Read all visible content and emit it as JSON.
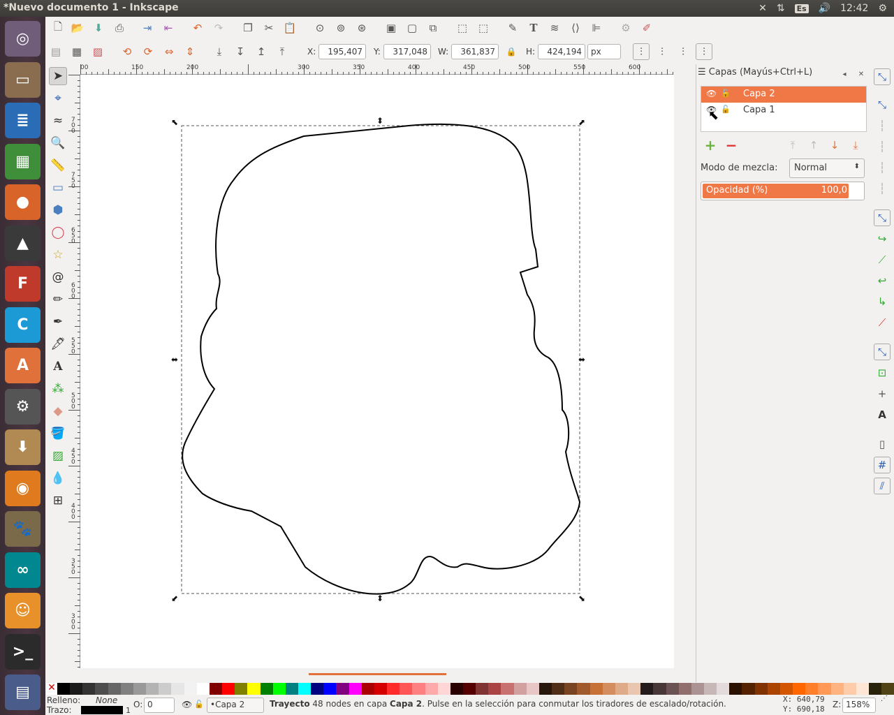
{
  "window": {
    "title": "*Nuevo documento 1 - Inkscape"
  },
  "tray": {
    "lang": "Es",
    "time": "12:42"
  },
  "launcher": [
    {
      "name": "ubuntu-dash-icon",
      "glyph": "◎",
      "bg": "#6f5d7a"
    },
    {
      "name": "files-icon",
      "glyph": "▭",
      "bg": "#8a6c4f"
    },
    {
      "name": "writer-icon",
      "glyph": "≣",
      "bg": "#2a6db6"
    },
    {
      "name": "calc-icon",
      "glyph": "▦",
      "bg": "#3f8f3a"
    },
    {
      "name": "firefox-icon",
      "glyph": "●",
      "bg": "#d9642a"
    },
    {
      "name": "inkscape-icon",
      "glyph": "▲",
      "bg": "#3a3a3a"
    },
    {
      "name": "fritzing-icon",
      "glyph": "F",
      "bg": "#c03a2b"
    },
    {
      "name": "cmaptools-icon",
      "glyph": "C",
      "bg": "#1b9ad6"
    },
    {
      "name": "software-center-icon",
      "glyph": "A",
      "bg": "#e1713a"
    },
    {
      "name": "settings-icon",
      "glyph": "⚙",
      "bg": "#555"
    },
    {
      "name": "archive-icon",
      "glyph": "⬇",
      "bg": "#b08a52"
    },
    {
      "name": "blender-icon",
      "glyph": "◉",
      "bg": "#e07a1f"
    },
    {
      "name": "gimp-icon",
      "glyph": "🐾",
      "bg": "#7a6a4a"
    },
    {
      "name": "arduino-icon",
      "glyph": "∞",
      "bg": "#00878f"
    },
    {
      "name": "scratch-icon",
      "glyph": "☺",
      "bg": "#e8902a"
    },
    {
      "name": "terminal-icon",
      "glyph": ">_",
      "bg": "#2b2b2b"
    },
    {
      "name": "workspace-icon",
      "glyph": "▤",
      "bg": "#4a5c8a"
    }
  ],
  "toolbar": {
    "x_label": "X:",
    "x_value": "195,407",
    "y_label": "Y:",
    "y_value": "317,048",
    "w_label": "W:",
    "w_value": "361,837",
    "h_label": "H:",
    "h_value": "424,194",
    "unit": "px"
  },
  "ruler": {
    "h_ticks": [
      "00",
      "150",
      "200",
      "300",
      "350",
      "400",
      "450",
      "500",
      "550",
      "600"
    ],
    "v_ticks": [
      "7",
      "0",
      "0",
      "7",
      "5",
      "0",
      "6",
      "5",
      "0",
      "6",
      "0",
      "0",
      "5",
      "5",
      "0",
      "5",
      "0",
      "0",
      "4",
      "5",
      "0",
      "4",
      "0",
      "0",
      "3",
      "5",
      "0",
      "3",
      "0",
      "0"
    ]
  },
  "layers": {
    "title": "Capas (Mayús+Ctrl+L)",
    "items": [
      {
        "name": "Capa 2",
        "selected": true
      },
      {
        "name": "Capa 1",
        "selected": false
      }
    ],
    "blend_label": "Modo de mezcla:",
    "blend_value": "Normal",
    "opacity_label": "Opacidad (%)",
    "opacity_value": "100,0",
    "opacity_fraction": 1.0
  },
  "status": {
    "fill_label": "Relleno:",
    "fill_value": "None",
    "stroke_label": "Trazo:",
    "stroke_width": "1",
    "o_label": "O:",
    "o_value": "0",
    "layer": "•Capa 2",
    "msg_bold1": "Trayecto",
    "msg1": " 48 nodes en capa ",
    "msg_bold2": "Capa 2",
    "msg2": ". Pulse en la selección para conmutar los tiradores de escalado/rotación.",
    "cx": "X:  640,79",
    "cy": "Y:  690,18",
    "zoom_label": "Z:",
    "zoom": "158%"
  },
  "palette": [
    "#000000",
    "#1a1a1a",
    "#333333",
    "#4d4d4d",
    "#666666",
    "#808080",
    "#999999",
    "#b3b3b3",
    "#cccccc",
    "#e6e6e6",
    "#f2f2f2",
    "#ffffff",
    "#800000",
    "#ff0000",
    "#808000",
    "#ffff00",
    "#008000",
    "#00ff00",
    "#008080",
    "#00ffff",
    "#000080",
    "#0000ff",
    "#800080",
    "#ff00ff",
    "#aa0000",
    "#d40000",
    "#ff2a2a",
    "#ff5555",
    "#ff8080",
    "#ffaaaa",
    "#ffd5d5",
    "#2b0000",
    "#550000",
    "#803333",
    "#aa4444",
    "#c87171",
    "#d3a0a0",
    "#e9c6c6",
    "#28170b",
    "#502d16",
    "#784421",
    "#a05a2c",
    "#c87137",
    "#d38d5f",
    "#deaa87",
    "#e9c6af",
    "#241c1c",
    "#483737",
    "#6c5353",
    "#916f6f",
    "#ac9393",
    "#c8b7b7",
    "#e3dbdb",
    "#2b1100",
    "#552200",
    "#803300",
    "#aa4400",
    "#d45500",
    "#ff6600",
    "#ff7f2a",
    "#ff9955",
    "#ffb380",
    "#ffccaa",
    "#ffe6d5",
    "#28220b",
    "#504416"
  ]
}
